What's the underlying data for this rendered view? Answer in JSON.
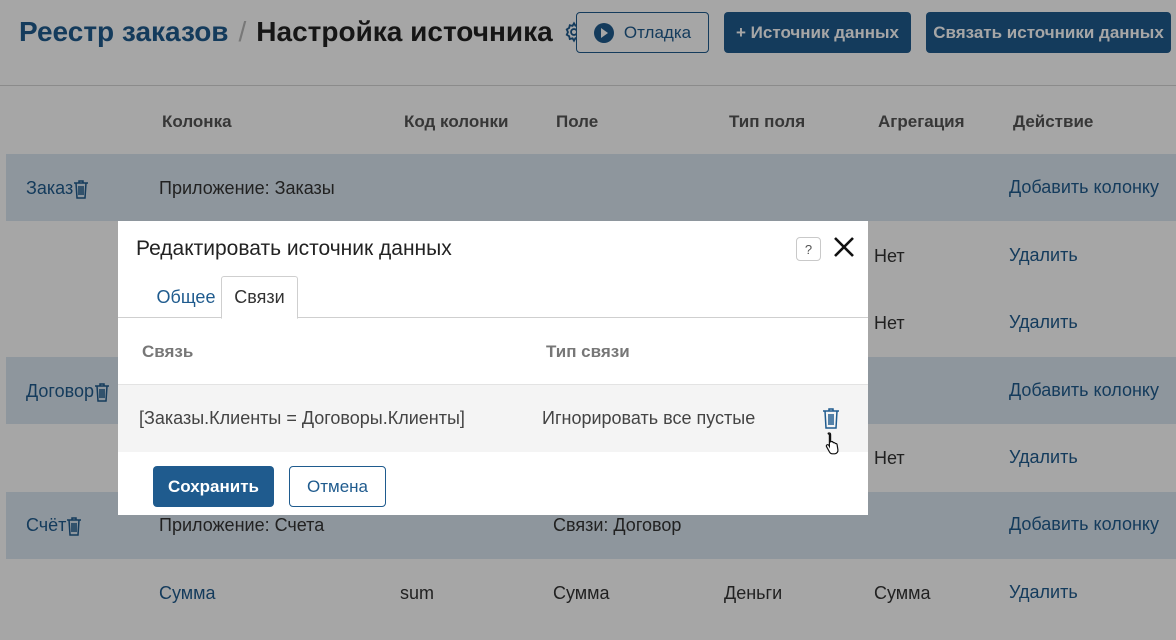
{
  "header": {
    "breadcrumb_root": "Реестр заказов",
    "separator": "/",
    "title": "Настройка источника",
    "debug_button": "Отладка",
    "add_source_button": "+ Источник данных",
    "link_sources_button": "Связать источники данных"
  },
  "table": {
    "columns": [
      "Колонка",
      "Код колонки",
      "Поле",
      "Тип поля",
      "Агрегация",
      "Действие"
    ],
    "rows": [
      {
        "group": "Заказ",
        "column": "Приложение: Заказы",
        "code": "",
        "field": "",
        "type": "",
        "aggregation": "",
        "action": "Добавить колонку"
      },
      {
        "group": "",
        "column": "",
        "code": "",
        "field": "",
        "type": "",
        "aggregation": "Нет",
        "action": "Удалить"
      },
      {
        "group": "",
        "column": "",
        "code": "",
        "field": "",
        "type": "",
        "aggregation": "Нет",
        "action": "Удалить"
      },
      {
        "group": "Договор",
        "column": "",
        "code": "",
        "field": "",
        "type": "",
        "aggregation": "",
        "action": "Добавить колонку"
      },
      {
        "group": "",
        "column": "",
        "code": "",
        "field": "",
        "type": "",
        "aggregation": "Нет",
        "action": "Удалить"
      },
      {
        "group": "Счёт",
        "column": "Приложение: Счета",
        "code": "",
        "field": "Связи: Договор",
        "type": "",
        "aggregation": "",
        "action": "Добавить колонку"
      },
      {
        "group": "",
        "column": "Сумма",
        "code": "sum",
        "field": "Сумма",
        "type": "Деньги",
        "aggregation": "Сумма",
        "action": "Удалить"
      }
    ]
  },
  "modal": {
    "title": "Редактировать источник данных",
    "help": "?",
    "tabs": [
      "Общее",
      "Связи"
    ],
    "active_tab": "Связи",
    "columns": [
      "Связь",
      "Тип связи"
    ],
    "rows": [
      {
        "link": "[Заказы.Клиенты = Договоры.Клиенты]",
        "link_type": "Игнорировать все пустые"
      }
    ],
    "save": "Сохранить",
    "cancel": "Отмена"
  },
  "colors": {
    "accent": "#1f5b8e",
    "group_row": "#dbe7f1",
    "overlay": "rgba(0,0,0,0.35)"
  }
}
